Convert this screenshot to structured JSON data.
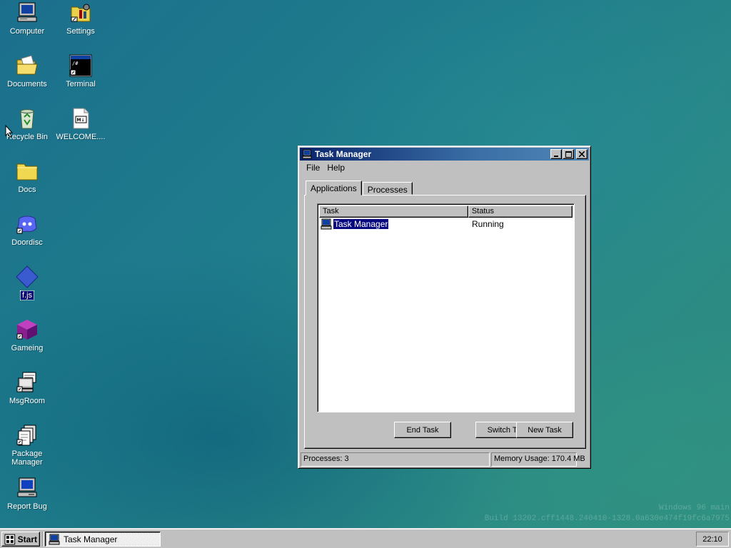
{
  "desktop": {
    "icons": [
      {
        "label": "Computer",
        "icon": "computer-icon"
      },
      {
        "label": "Settings",
        "icon": "settings-icon"
      },
      {
        "label": "Documents",
        "icon": "folder-open-icon"
      },
      {
        "label": "Terminal",
        "icon": "terminal-icon"
      },
      {
        "label": "Recycle Bin",
        "icon": "recycle-bin-icon"
      },
      {
        "label": "WELCOME....",
        "icon": "markdown-file-icon"
      },
      {
        "label": "Docs",
        "icon": "folder-icon"
      },
      {
        "label": "Doordisc",
        "icon": "doordisc-icon"
      },
      {
        "label": "f.js",
        "icon": "diamond-file-icon"
      },
      {
        "label": "Gameing",
        "icon": "game-cube-icon"
      },
      {
        "label": "MsgRoom",
        "icon": "msgroom-icon"
      },
      {
        "label": "Package Manager",
        "icon": "package-manager-icon"
      },
      {
        "label": "Report Bug",
        "icon": "report-bug-icon"
      }
    ],
    "watermark": {
      "line1": "Windows 96 main",
      "line2": "Build 13202.cff1448.240410-1328.0a630e474f19fc6a7975"
    }
  },
  "window": {
    "title": "Task Manager",
    "menu": [
      "File",
      "Help"
    ],
    "tabs": [
      {
        "label": "Applications",
        "active": true
      },
      {
        "label": "Processes",
        "active": false
      }
    ],
    "columns": [
      "Task",
      "Status"
    ],
    "rows": [
      {
        "task": "Task Manager",
        "status": "Running",
        "selected": true
      }
    ],
    "buttons": {
      "end_task": "End Task",
      "switch_to": "Switch To",
      "new_task": "New Task"
    },
    "status": {
      "processes": "Processes: 3",
      "memory": "Memory Usage: 170.4 MB"
    }
  },
  "taskbar": {
    "start_label": "Start",
    "tasks": [
      {
        "label": "Task Manager",
        "icon": "task-manager-icon"
      }
    ],
    "clock": "22:10"
  },
  "colors": {
    "selection": "#0a0a80",
    "titlebar_start": "#0a246a",
    "titlebar_end": "#4f87b8",
    "face": "#c0c0c0"
  }
}
